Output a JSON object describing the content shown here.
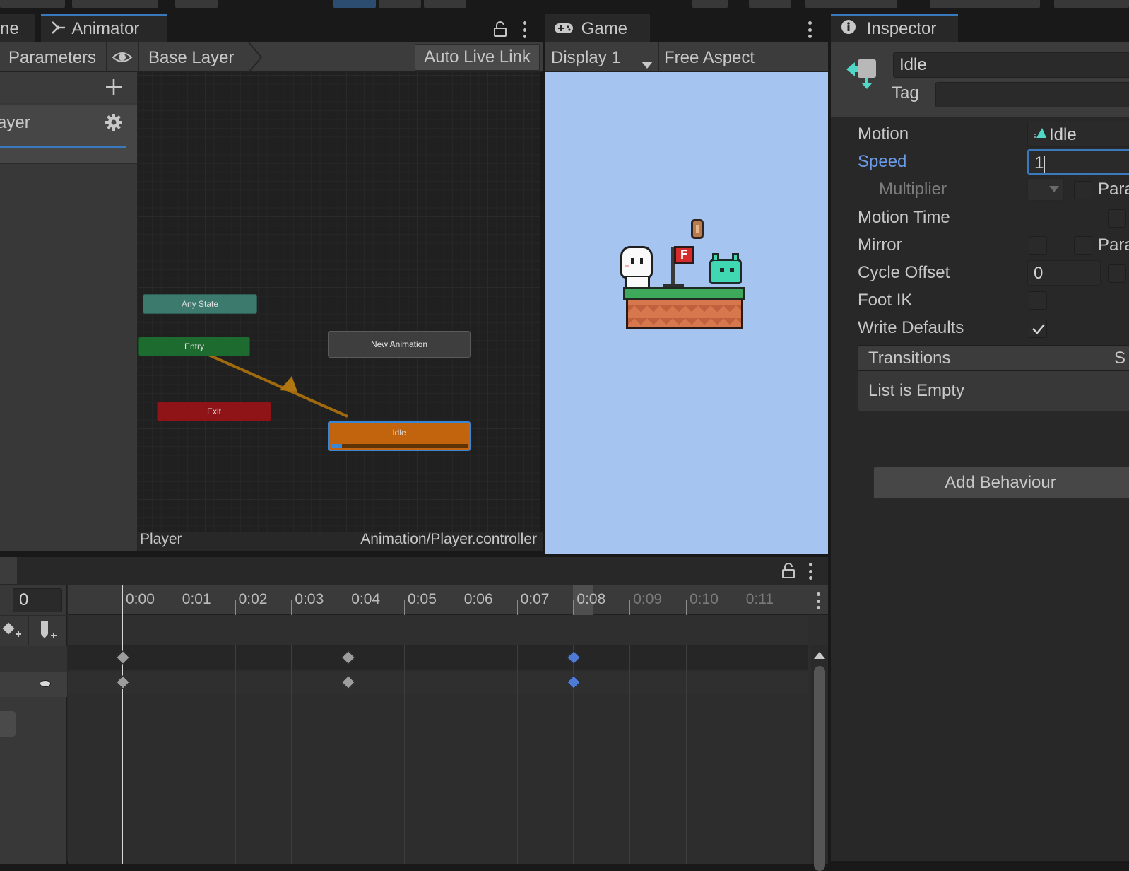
{
  "animator": {
    "tab_partial": "ne",
    "tab_title": "Animator",
    "parameters_tab": "Parameters",
    "breadcrumb": "Base Layer",
    "auto_live_link": "Auto Live Link",
    "layer_partial": "ayer",
    "footer_left": "Player",
    "footer_right": "Animation/Player.controller",
    "nodes": {
      "any_state": "Any State",
      "entry": "Entry",
      "exit": "Exit",
      "new_animation": "New Animation",
      "idle": "Idle"
    },
    "idle_progress": 0.08
  },
  "game": {
    "tab_title": "Game",
    "display": "Display 1",
    "aspect": "Free Aspect",
    "flag_letter": "F",
    "colors": {
      "sky": "#a5c4ef",
      "grass": "#3ea85b",
      "dirt": "#d6774d",
      "slime": "#3fd8b2"
    }
  },
  "inspector": {
    "tab_title": "Inspector",
    "state_name": "Idle",
    "tag_label": "Tag",
    "tag_value": "",
    "motion_label": "Motion",
    "motion_value": "Idle",
    "speed_label": "Speed",
    "speed_value": "1",
    "multiplier_label": "Multiplier",
    "parameter_partial": "Para",
    "motion_time_label": "Motion Time",
    "mirror_label": "Mirror",
    "cycle_offset_label": "Cycle Offset",
    "cycle_offset_value": "0",
    "foot_ik_label": "Foot IK",
    "write_defaults_label": "Write Defaults",
    "write_defaults": true,
    "transitions_title": "Transitions",
    "transitions_partial": "S",
    "transitions_empty": "List is Empty",
    "add_behaviour": "Add Behaviour"
  },
  "animation": {
    "frame_value": "0",
    "ruler_labels": [
      "0:00",
      "0:01",
      "0:02",
      "0:03",
      "0:04",
      "0:05",
      "0:06",
      "0:07",
      "0:08",
      "0:09",
      "0:10",
      "0:11"
    ],
    "keyframe_times": [
      "0:00",
      "0:04",
      "0:08"
    ]
  },
  "colors": {
    "accent": "#3a79bb",
    "link_blue": "#6b9be6",
    "idle_orange": "#c2630e",
    "entry_green": "#1d6b2f",
    "exit_red": "#8e1418",
    "any_state_teal": "#3d7a6e"
  }
}
